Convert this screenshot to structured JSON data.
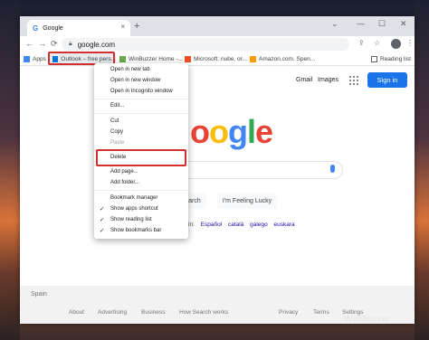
{
  "browser": {
    "tab": {
      "favicon": "G",
      "title": "Google",
      "close": "×"
    },
    "new_tab": "+",
    "window_controls": {
      "minimize": "—",
      "maximize": "☐",
      "close": "✕",
      "cast": "⌄"
    },
    "toolbar": {
      "back": "←",
      "forward": "→",
      "reload": "⟳",
      "url": "google.com",
      "share": "⇪",
      "star": "☆",
      "menu": "⋮"
    }
  },
  "bookmarks_bar": {
    "items": [
      {
        "label": "Apps",
        "color": "#4285f4"
      },
      {
        "label": "Outlook – free pers...",
        "color": "#0078d4"
      },
      {
        "label": "WinBuzzer Home -...",
        "color": "#6aa84f"
      },
      {
        "label": "Microsoft: nube, or...",
        "color": "#f25022"
      },
      {
        "label": "Amazon.com. Spen...",
        "color": "#ff9900"
      }
    ],
    "reading_list": "Reading list"
  },
  "google": {
    "nav": {
      "gmail": "Gmail",
      "images": "Images",
      "signin": "Sign in"
    },
    "logo_visible": "oogle",
    "buttons": {
      "search": "earch",
      "lucky": "I'm Feeling Lucky"
    },
    "langs_prefix": "in:",
    "langs": [
      "Español",
      "català",
      "galego",
      "euskara"
    ],
    "footer": {
      "country": "Spain",
      "left_links": [
        "About",
        "Advertising",
        "Business",
        "How Search works"
      ],
      "right_links": [
        "Privacy",
        "Terms",
        "Settings"
      ]
    }
  },
  "context_menu": {
    "items": [
      {
        "label": "Open in new tab"
      },
      {
        "label": "Open in new window"
      },
      {
        "label": "Open in Incognito window"
      },
      {
        "label": "Edit..."
      },
      {
        "label": "Cut"
      },
      {
        "label": "Copy"
      },
      {
        "label": "Paste"
      },
      {
        "label": "Delete"
      },
      {
        "label": "Add page..."
      },
      {
        "label": "Add folder..."
      },
      {
        "label": "Bookmark manager"
      },
      {
        "label": "Show apps shortcut"
      },
      {
        "label": "Show reading list"
      },
      {
        "label": "Show bookmarks bar"
      }
    ],
    "check": "✓"
  },
  "watermark": "WinBuzzer"
}
